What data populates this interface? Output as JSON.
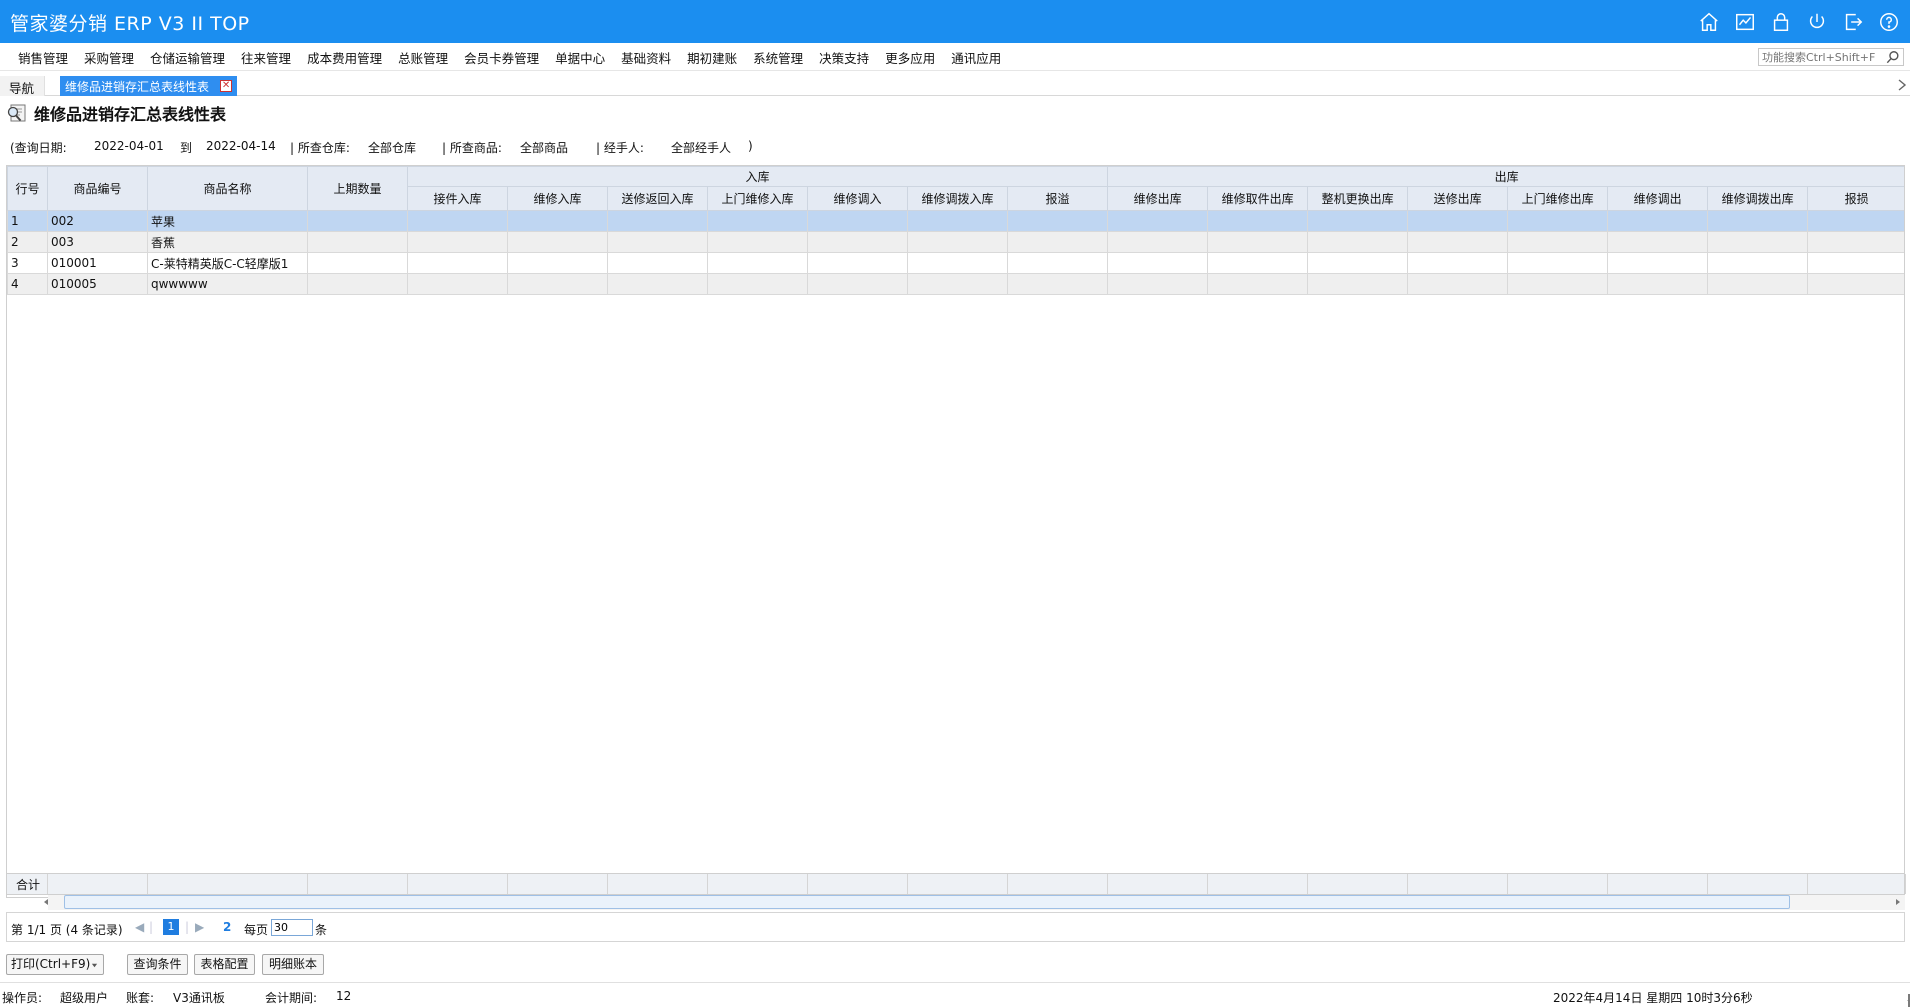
{
  "app": {
    "title": "管家婆分销 ERP V3 II TOP"
  },
  "menu": {
    "items": [
      "销售管理",
      "采购管理",
      "仓储运输管理",
      "往来管理",
      "成本费用管理",
      "总账管理",
      "会员卡券管理",
      "单据中心",
      "基础资料",
      "期初建账",
      "系统管理",
      "决策支持",
      "更多应用",
      "通讯应用"
    ],
    "search_placeholder": "功能搜索Ctrl+Shift+F"
  },
  "tabs": {
    "nav_label": "导航",
    "active_label": "维修品进销存汇总表线性表"
  },
  "page": {
    "title": "维修品进销存汇总表线性表"
  },
  "query": {
    "date_label": "(查询日期:",
    "start_date": "2022-04-01",
    "to_label": "到",
    "end_date": "2022-04-14",
    "warehouse_label": "| 所查仓库:",
    "warehouse_value": "全部仓库",
    "product_label": "| 所查商品:",
    "product_value": "全部商品",
    "handler_label": "| 经手人:",
    "handler_value": "全部经手人",
    "close_paren": ")"
  },
  "table": {
    "headers": {
      "row_no": "行号",
      "code": "商品编号",
      "name": "商品名称",
      "prev_qty": "上期数量",
      "in_group": "入库",
      "out_group": "出库",
      "in_columns": [
        "接件入库",
        "维修入库",
        "送修返回入库",
        "上门维修入库",
        "维修调入",
        "维修调拨入库",
        "报溢"
      ],
      "out_columns": [
        "维修出库",
        "维修取件出库",
        "整机更换出库",
        "送修出库",
        "上门维修出库",
        "维修调出",
        "维修调拨出库",
        "报损"
      ]
    },
    "rows": [
      {
        "no": "1",
        "code": "002",
        "name": "苹果"
      },
      {
        "no": "2",
        "code": "003",
        "name": "香蕉"
      },
      {
        "no": "3",
        "code": "010001",
        "name": "C-莱特精英版C-C轻摩版1"
      },
      {
        "no": "4",
        "code": "010005",
        "name": "qwwwww"
      }
    ],
    "total_label": "合计"
  },
  "pager": {
    "summary": "第 1/1 页 (4 条记录)",
    "first": "◀",
    "prev": "◀",
    "current_page": "1",
    "next": "▶",
    "last": "2",
    "per_page_label": "每页",
    "per_page_value": "30",
    "unit": "条"
  },
  "buttons": {
    "print": "打印(Ctrl+F9)",
    "query_conditions": "查询条件",
    "table_config": "表格配置",
    "detail_ledger": "明细账本"
  },
  "status": {
    "operator_label": "操作员:",
    "operator": "超级用户",
    "account_label": "账套:",
    "account": "V3通讯板",
    "period_label": "会计期间:",
    "period": "12",
    "datetime": "2022年4月14日 星期四 10时3分6秒"
  }
}
